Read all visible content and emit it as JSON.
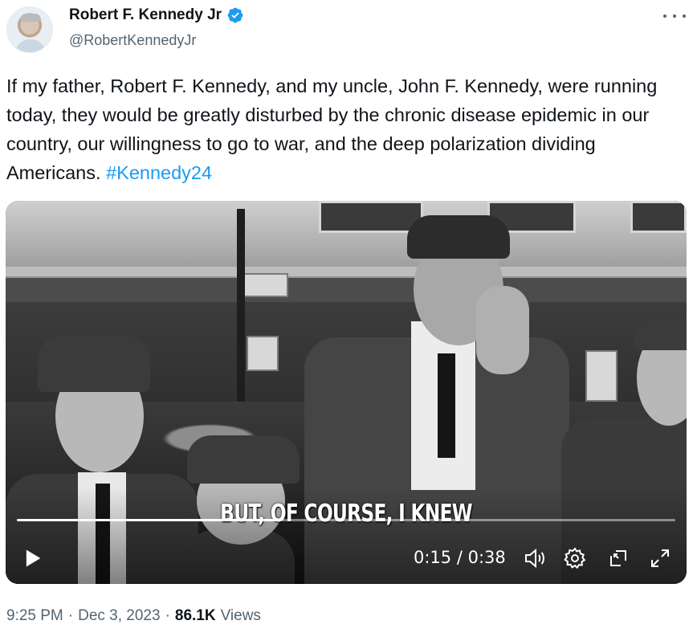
{
  "author": {
    "display_name": "Robert F. Kennedy Jr",
    "handle": "@RobertKennedyJr",
    "verified": true,
    "verified_color": "#1d9bf0"
  },
  "tweet": {
    "text": "If my father, Robert F. Kennedy, and my uncle, John F. Kennedy, were running today, they would be greatly disturbed by the chronic disease epidemic in our country, our willingness to go to war, and the deep polarization dividing Americans.",
    "hashtag": "#Kennedy24",
    "hashtag_color": "#1d9bf0"
  },
  "video": {
    "caption": "BUT, OF COURSE, I KNEW",
    "current_time": "0:15",
    "separator": "/",
    "duration": "0:38",
    "progress_fraction": 0.395,
    "controls": [
      "play-icon",
      "volume-icon",
      "settings-icon",
      "pop-out-icon",
      "fullscreen-icon"
    ]
  },
  "footer": {
    "time": "9:25 PM",
    "dot1": "·",
    "date": "Dec 3, 2023",
    "dot2": "·",
    "views_count": "86.1K",
    "views_label": "Views"
  },
  "icons": {
    "more": "more-options-icon",
    "verified": "verified-badge-icon"
  }
}
